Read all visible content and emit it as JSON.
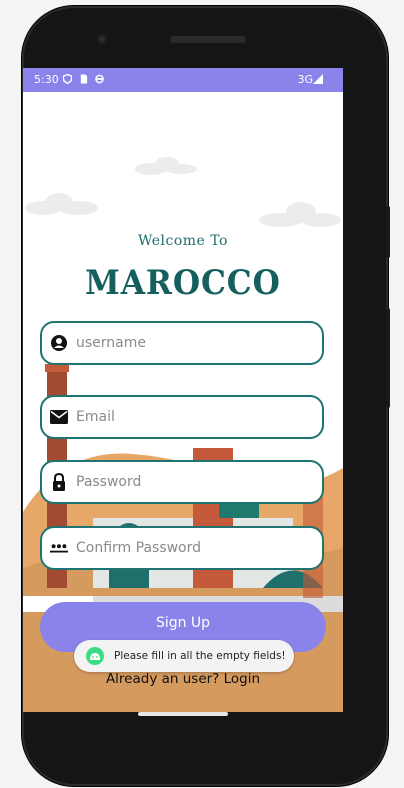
{
  "status_bar": {
    "time": "5:30",
    "network": "3G"
  },
  "welcome_text": "Welcome To",
  "brand": "MAROCCO",
  "fields": {
    "username": {
      "placeholder": "username",
      "value": ""
    },
    "email": {
      "placeholder": "Email",
      "value": ""
    },
    "password": {
      "placeholder": "Password",
      "value": ""
    },
    "confirm_password": {
      "placeholder": "Confirm Password",
      "value": ""
    }
  },
  "signup_label": "Sign Up",
  "toast_message": "Please fill in all the empty fields!",
  "login_link": "Already an user? Login",
  "colors": {
    "accent": "#8a84ea",
    "teal": "#1f7472",
    "sand": "#d59a5e"
  }
}
